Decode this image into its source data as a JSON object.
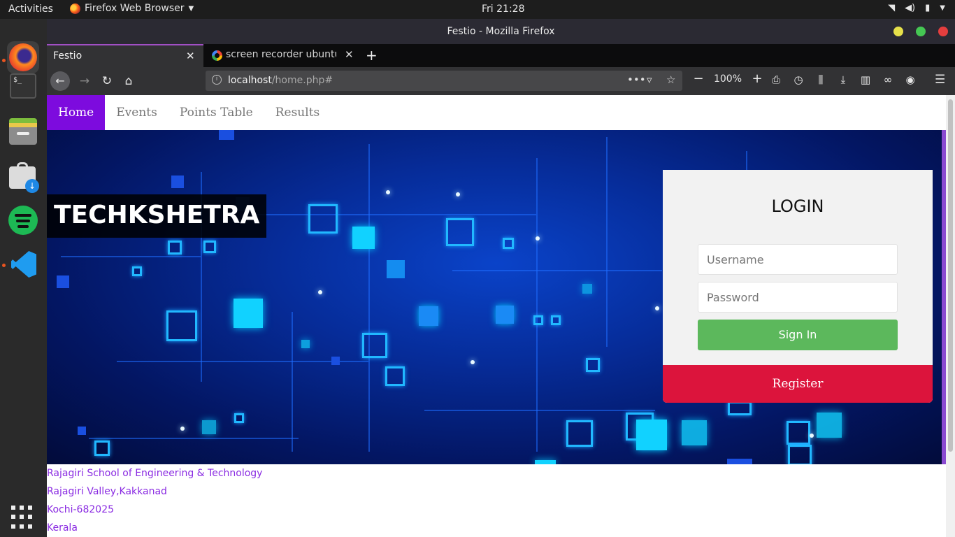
{
  "system": {
    "activities": "Activities",
    "app_menu": "Firefox Web Browser",
    "clock": "Fri 21:28"
  },
  "window": {
    "title": "Festio - Mozilla Firefox"
  },
  "tabs": [
    {
      "label": "Festio",
      "active": true
    },
    {
      "label": "screen recorder ubuntu",
      "active": false
    }
  ],
  "navbar": {
    "url_host": "localhost",
    "url_path": "/home.php#",
    "zoom": "100%"
  },
  "site": {
    "nav": [
      {
        "label": "Home",
        "active": true
      },
      {
        "label": "Events",
        "active": false
      },
      {
        "label": "Points Table",
        "active": false
      },
      {
        "label": "Results",
        "active": false
      }
    ],
    "brand": "TECHKSHETRA",
    "login": {
      "title": "LOGIN",
      "username_placeholder": "Username",
      "password_placeholder": "Password",
      "signin_label": "Sign In",
      "register_label": "Register"
    },
    "address": [
      "Rajagiri School of Engineering & Technology",
      "Rajagiri Valley,Kakkanad",
      "Kochi-682025",
      "Kerala"
    ]
  },
  "colors": {
    "nav_active": "#7d0bde",
    "signin": "#5cb85c",
    "register": "#dc143c",
    "address_text": "#8a2be2",
    "tab_accent": "#a14fc4"
  }
}
